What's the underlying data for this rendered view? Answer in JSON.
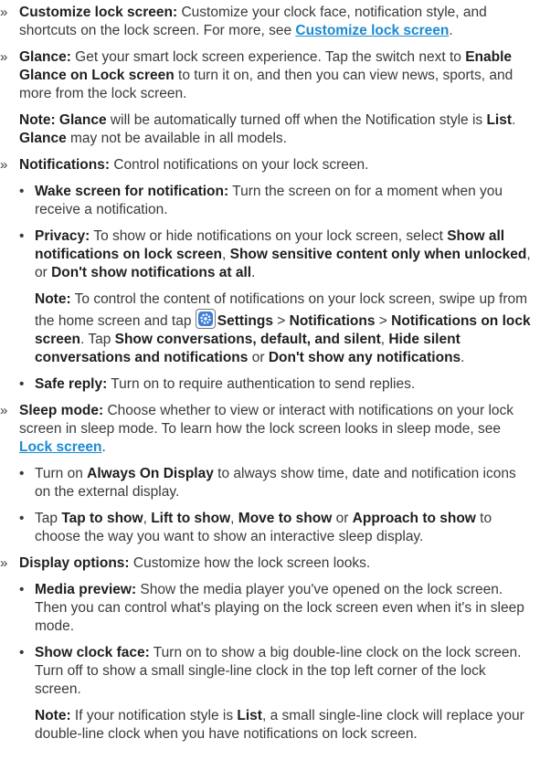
{
  "items": {
    "lock": {
      "chevron": "»",
      "title": "Customize lock screen:",
      "text1": " Customize your clock face, notification style, and shortcuts on the lock screen. For more, see ",
      "link": "Customize lock screen",
      "text2": "."
    },
    "glance": {
      "chevron": "»",
      "title": "Glance:",
      "text1": " Get your smart lock screen experience. Tap the switch next to ",
      "bold1": "Enable Glance on Lock screen",
      "text2": " to turn it on, and then you can view news, sports, and more from the lock screen.",
      "note_label": "Note:",
      "note_b1": "Glance",
      "note_t1": " will be automatically turned off when the Notification style is ",
      "note_b2": "List",
      "note_t2": ". ",
      "note_b3": "Glance",
      "note_t3": " may not be available in all models."
    },
    "notifications": {
      "chevron": "»",
      "title": "Notifications:",
      "text1": " Control notifications on your lock screen.",
      "wake": {
        "bullet": "•",
        "title": "Wake screen for notification:",
        "text": " Turn the screen on for a moment when you receive a notification."
      },
      "privacy": {
        "bullet": "•",
        "title": "Privacy:",
        "t1": " To show or hide notifications on your lock screen, select ",
        "b1": "Show all notifications on lock screen",
        "t2": ", ",
        "b2": "Show sensitive content only when unlocked",
        "t3": ", or ",
        "b3": "Don't show notifications at all",
        "t4": "."
      },
      "note": {
        "label": "Note:",
        "t1": " To control the content of notifications on your lock screen, swipe up from the home screen and tap ",
        "b1": "Settings",
        "t2": " > ",
        "b2": "Notifications",
        "t3": " > ",
        "b3": "Notifications on lock screen",
        "t4": ". Tap ",
        "b4": "Show conversations, default, and silent",
        "t5": ", ",
        "b5": "Hide silent conversations and notifications",
        "t6": " or ",
        "b6": "Don't show any notifications",
        "t7": "."
      },
      "safe": {
        "bullet": "•",
        "title": "Safe reply:",
        "text": " Turn on to require authentication to send replies."
      }
    },
    "sleep": {
      "chevron": "»",
      "title": "Sleep mode:",
      "text1": " Choose whether to view or interact with notifications on your lock screen in sleep mode. To learn how the lock screen looks in sleep mode, see ",
      "link": "Lock screen",
      "text2": ".",
      "aod": {
        "bullet": "•",
        "t1": "Turn on ",
        "b1": "Always On Display",
        "t2": " to always show time, date and notification icons on the external display."
      },
      "tap": {
        "bullet": "•",
        "t1": "Tap ",
        "b1": "Tap to show",
        "t2": ", ",
        "b2": "Lift to show",
        "t3": ", ",
        "b3": "Move to show",
        "t4": " or ",
        "b4": "Approach to show",
        "t5": " to choose the way you want to show an interactive sleep display."
      }
    },
    "display": {
      "chevron": "»",
      "title": "Display options:",
      "text1": " Customize how the lock screen looks.",
      "media": {
        "bullet": "•",
        "title": "Media preview:",
        "text": " Show the media player you've opened on the lock screen. Then you can control what's playing on the lock screen even when it's in sleep mode."
      },
      "clock": {
        "bullet": "•",
        "title": "Show clock face:",
        "text": " Turn on to show a big double-line clock on the lock screen. Turn off to show a small single-line clock in the top left corner of the lock screen."
      },
      "note": {
        "label": "Note:",
        "t1": " If your notification style is ",
        "b1": "List",
        "t2": ", a small single-line clock will replace your double-line clock when you have notifications on lock screen."
      }
    }
  },
  "icons": {
    "settings": "settings-gear-icon"
  },
  "colors": {
    "link": "#1a8ad4",
    "icon_blue": "#3d7fd6"
  }
}
